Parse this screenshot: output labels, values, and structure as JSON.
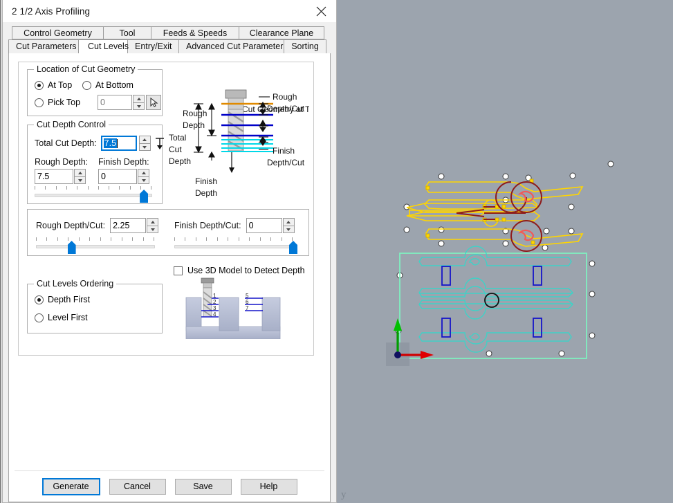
{
  "window": {
    "title": "2 1/2 Axis Profiling",
    "close_icon": "close-icon"
  },
  "tabs": {
    "row1": [
      {
        "label": "Control Geometry",
        "active": false
      },
      {
        "label": "Tool",
        "active": false
      },
      {
        "label": "Feeds & Speeds",
        "active": false
      },
      {
        "label": "Clearance Plane",
        "active": false
      }
    ],
    "row2": [
      {
        "label": "Cut Parameters",
        "active": false
      },
      {
        "label": "Cut Levels",
        "active": true
      },
      {
        "label": "Entry/Exit",
        "active": false
      },
      {
        "label": "Advanced Cut Parameters",
        "active": false
      },
      {
        "label": "Sorting",
        "active": false
      }
    ]
  },
  "location_group": {
    "legend": "Location of Cut Geometry",
    "at_top": "At Top",
    "at_bottom": "At Bottom",
    "pick_top": "Pick Top",
    "pick_top_value": "0",
    "selected": "At Top",
    "pick_icon": "cursor-arrow-icon"
  },
  "cut_depth_group": {
    "legend": "Cut Depth Control",
    "total_cut_depth_label": "Total Cut Depth:",
    "total_cut_depth_value": "7.5",
    "total_depth_icon": "measure-depth-icon",
    "rough_depth_label": "Rough Depth:",
    "rough_depth_value": "7.5",
    "finish_depth_label": "Finish Depth:",
    "finish_depth_value": "0",
    "rough_slider_percent": 93,
    "finish_slider_percent": 100
  },
  "depth_per_cut": {
    "rough_label": "Rough Depth/Cut:",
    "rough_value": "2.25",
    "finish_label": "Finish Depth/Cut:",
    "finish_value": "0",
    "rough_slider_percent": 30,
    "finish_slider_percent": 100
  },
  "detect_depth": {
    "label": "Use 3D Model to Detect Depth",
    "checked": false
  },
  "ordering_group": {
    "legend": "Cut Levels Ordering",
    "depth_first": "Depth First",
    "level_first": "Level First",
    "selected": "Depth First",
    "diagram_levels_left": [
      "1",
      "2",
      "3",
      "4"
    ],
    "diagram_levels_right": [
      "5",
      "6",
      "7"
    ]
  },
  "depth_diagram": {
    "cut_geometry_at_top": "Cut Geometry at Top",
    "rough_depth": "Rough\nDepth",
    "total_cut_depth": "Total\nCut\nDepth",
    "finish_depth": "Finish\nDepth",
    "rough_depth_cut": "Rough\nDepth/Cut",
    "finish_depth_cut": "Finish\nDepth/Cut",
    "labels": {
      "rough_depth_l1": "Rough",
      "rough_depth_l2": "Depth",
      "total_l1": "Total",
      "total_l2": "Cut",
      "total_l3": "Depth",
      "finish_depth_l1": "Finish",
      "finish_depth_l2": "Depth",
      "rough_cut_l1": "Rough",
      "rough_cut_l2": "Depth/Cut",
      "finish_cut_l1": "Finish",
      "finish_cut_l2": "Depth/Cut",
      "top_label": "Cut Geometry at Top"
    }
  },
  "buttons": {
    "generate": "Generate",
    "cancel": "Cancel",
    "save": "Save",
    "help": "Help"
  },
  "viewport": {
    "axis_y_label": "y",
    "background_color": "#9ca4ae",
    "toolpath_color": "#ffd500",
    "rapid_color": "#8e1c1c",
    "part_color": "#3fd2c7",
    "boundary_color": "#7ff0c0",
    "tab_color": "#1414c8",
    "lead_color": "#f05a5a"
  }
}
